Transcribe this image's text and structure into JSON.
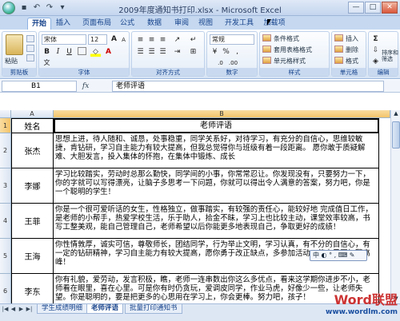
{
  "window": {
    "title": "2009年度通知书打印.xlsx - Microsoft Excel",
    "minimize": "—",
    "maximize": "□",
    "close": "✕"
  },
  "ribbon_tabs": [
    "开始",
    "插入",
    "页面布局",
    "公式",
    "数据",
    "审阅",
    "视图",
    "开发工具",
    "加载项"
  ],
  "ribbon": {
    "clipboard": {
      "label": "剪贴板",
      "paste": "粘贴"
    },
    "font": {
      "label": "字体",
      "font_name": "宋体",
      "font_size": "12",
      "bold": "B",
      "italic": "I",
      "underline": "U",
      "grow": "A",
      "shrink": "A"
    },
    "alignment": {
      "label": "对齐方式"
    },
    "number": {
      "label": "数字",
      "format": "常规",
      "percent": "%",
      "comma": ","
    },
    "styles": {
      "label": "样式",
      "conditional": "条件格式",
      "table": "套用表格格式",
      "cell": "单元格样式"
    },
    "cells": {
      "label": "单元格",
      "insert": "插入",
      "delete": "删除",
      "format": "格式"
    },
    "editing": {
      "label": "编辑",
      "sum": "Σ",
      "sort": "排序和筛选",
      "find": "查找和选择"
    }
  },
  "formula_bar": {
    "name_box": "B1",
    "fx": "fx",
    "value": "老师评语"
  },
  "columns": {
    "a": "A",
    "b": "B"
  },
  "rows": [
    {
      "num": "1",
      "name": "姓名",
      "comment": "老师评语"
    },
    {
      "num": "2",
      "name": "张杰",
      "comment": "思想上进，待人随和、诚恳，处事稳重，同学关系好，对待学习，有充分的自信心，思维较敏捷，肯钻研，学习自主能力有较大提高，但我总觉得你与班级有着一段距离。 愿你敢于质疑解难、大胆发言，投入集体的怀抱，在集体中锻炼、成长"
    },
    {
      "num": "3",
      "name": "李娜",
      "comment": "学习比较踏实，劳动时总那么勤快，同学间的小事，你常常忍让。你发现没有，只要努力一下，你的字就可以写得漂亮，让脑子多思考一下问题，你就可以得出令人满意的答案，努力吧，你是一个聪明的学生！"
    },
    {
      "num": "4",
      "name": "王菲",
      "comment": "你是一个很可爱听话的女生，性格独立，做事踏实，有较强的责任心，能较好地 完成值日工作，是老师的小帮手，热爱学校生活，乐于助人，拾金不昧，学习上也比较主动，课堂效率较高，书写工整美观，能自己管理自己，老师希望以后你能更多地表现自己，争取更好的成绩！"
    },
    {
      "num": "5",
      "name": "王海",
      "comment": "你性情敦厚，诚实可信，尊敬师长，团结同学，行为举止文明，学习认真，有不分的自信心，有一定的钻研精神，学习自主能力有较大提高，愿你勇于改正缺点，多参加活动，使自己更加擎高峰！"
    },
    {
      "num": "6",
      "name": "李东",
      "comment": "你有礼貌，爱劳动，发言积极，瞧，老师一连串数出你这么多优点，看来这学期你进步不小，老师看在眼里，喜在心里。可是你有时仍贪玩，爱调皮同学，作业马虎，好像少一些，让老师失望。你是聪明的，要是把更多的心思用在学习上，你会更棒。努力吧，孩子！"
    }
  ],
  "sheet_tabs": [
    "学生成绩明细",
    "老师评语",
    "批量打印通知书"
  ],
  "ime_toolbar": "中 ◐ ° , ⌨ ✎",
  "watermark": {
    "line1": "Word联盟",
    "line2": "www.wordlm.com"
  }
}
